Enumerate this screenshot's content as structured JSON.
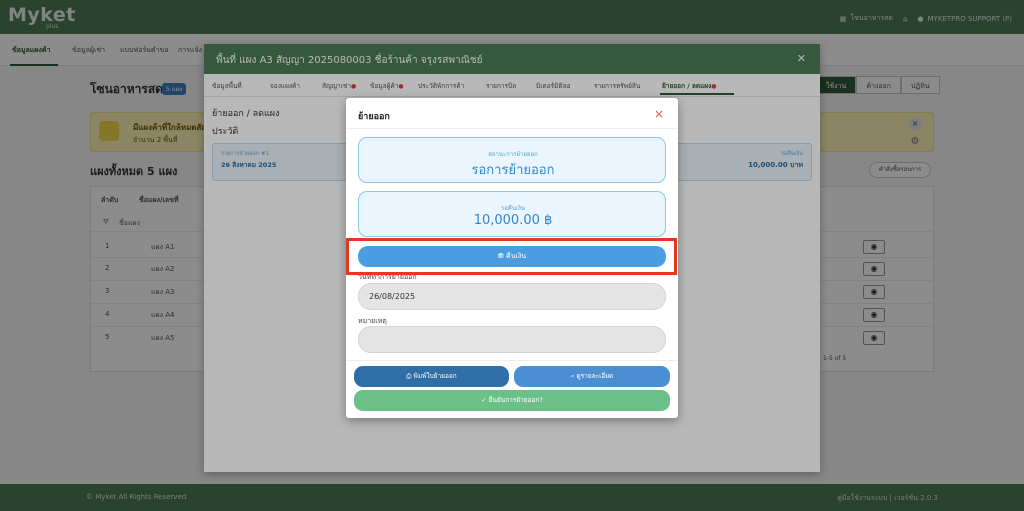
{
  "app": {
    "logo": "Myket",
    "logo_sub": "plus",
    "header_right": {
      "zone": "โซนอาหารสด",
      "user": "MYKETPRO SUPPORT (P)"
    },
    "footer_left": "© Myket All Rights Reserved",
    "footer_right": "คู่มือใช้งานระบบ | เวอร์ชั่น 2.0.3"
  },
  "nav_tabs": [
    "ข้อมูลแผงค้า",
    "ข้อมูลผู้เช่า",
    "แบบฟอร์มคำขอ",
    "การแจ้ง"
  ],
  "page": {
    "zone_title": "โซนอาหารสด",
    "zone_badge": "5 แผง",
    "seg_buttons": [
      "ใช้งาน",
      "ค้างออก",
      "ปฏิทิน"
    ],
    "alert_title": "มีแผงค้าที่ใกล้หมดสัญญา",
    "alert_sub": "จำนวน 2 พื้นที่",
    "stalls_title": "แผงทั้งหมด 5 แผง",
    "template_button": "คำสั่งซื้อรอบการ",
    "table_headers": [
      "ลำดับ",
      "ชื่อแผง/เลขที่"
    ],
    "filter_label": "ชื่อแผง",
    "rows": [
      {
        "no": "1",
        "name": "แผง A1"
      },
      {
        "no": "2",
        "name": "แผง A2"
      },
      {
        "no": "3",
        "name": "แผง A3"
      },
      {
        "no": "4",
        "name": "แผง A4"
      },
      {
        "no": "5",
        "name": "แผง A5"
      }
    ],
    "pagination": "1-5 of 5"
  },
  "big_modal": {
    "title": "พื้นที่ แผง A3 สัญญา 2025080003 ชื่อร้านค้า จรุงรสพาณิชย์",
    "tabs": [
      {
        "label": "ข้อมูลพื้นที่",
        "dot": false
      },
      {
        "label": "จองแผงค้า",
        "dot": false
      },
      {
        "label": "สัญญาเช่า",
        "dot": true
      },
      {
        "label": "ข้อมูลผู้ค้า",
        "dot": true
      },
      {
        "label": "ประวัติพักการค้า",
        "dot": false
      },
      {
        "label": "รายการบิล",
        "dot": false
      },
      {
        "label": "มิเตอร์มิติลอ",
        "dot": false
      },
      {
        "label": "รายการทรัพย์สิน",
        "dot": false
      },
      {
        "label": "ย้ายออก / ลดแผง",
        "dot": true
      }
    ],
    "section_title": "ย้ายออก / ลดแผง",
    "history_title": "ประวัติ",
    "history_item_label": "รายการย้ายออก #1",
    "history_item_date": "26 สิงหาคม 2025",
    "history_refund_label": "รอคืนเงิน",
    "history_refund_value": "10,000.00 บาท"
  },
  "dialog": {
    "title": "ย้ายออก",
    "status_label": "สถานะการย้ายออก",
    "status_value": "รอการย้ายออก",
    "refund_label": "รอคืนเงิน",
    "refund_value": "10,000.00 ฿",
    "refund_button": "คืนเงิน",
    "date_label": "วันที่ทำการย้ายออก",
    "date_value": "26/08/2025",
    "note_label": "หมายเหตุ",
    "note_value": "",
    "print_button": "พิมพ์ใบย้ายออก",
    "detail_button": "ดูรายละเอียด",
    "confirm_button": "ยืนยันการย้ายออก?"
  },
  "colors": {
    "brand_green": "#4b7a55",
    "accent_blue": "#4a9de0",
    "highlight_red": "#e23a22",
    "confirm_green": "#6cbf88"
  }
}
